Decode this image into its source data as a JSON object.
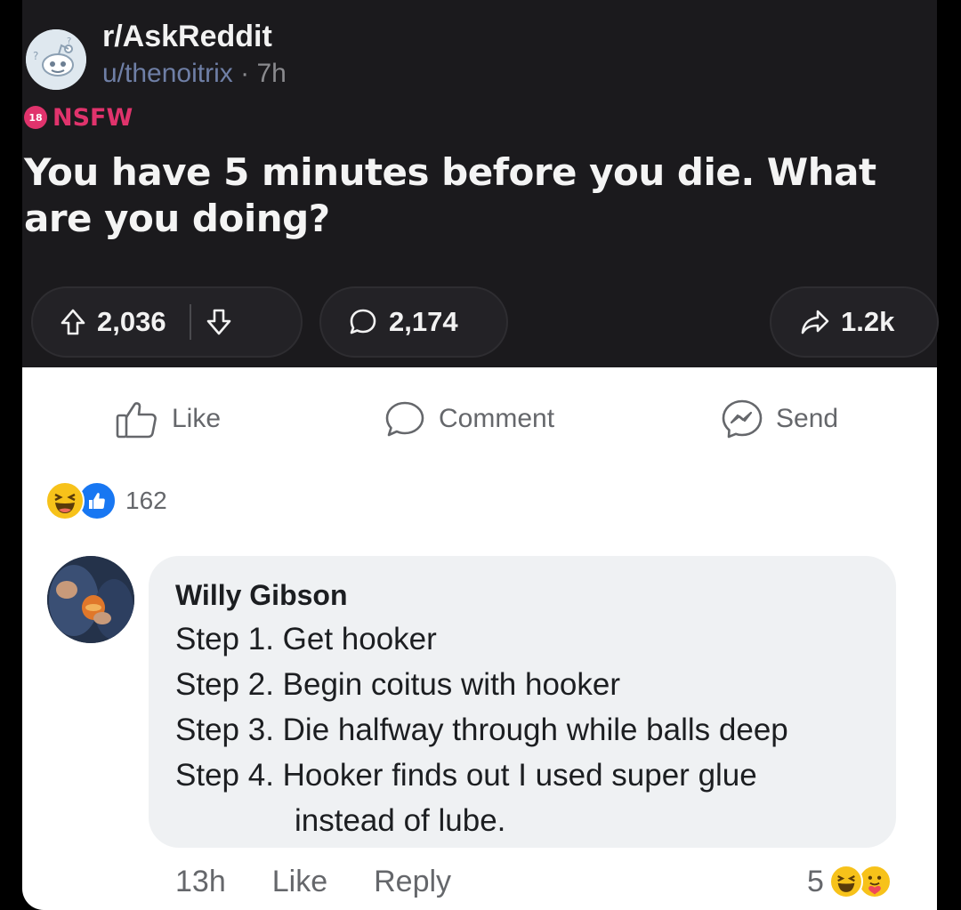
{
  "reddit_post": {
    "subreddit": "r/AskReddit",
    "author": "u/thenoitrix",
    "separator": "·",
    "age": "7h",
    "nsfw_label": "NSFW",
    "title": "You have 5 minutes before you die. What are you doing?",
    "upvotes": "2,036",
    "comments": "2,174",
    "shares": "1.2k"
  },
  "facebook": {
    "actions": {
      "like_label": "Like",
      "comment_label": "Comment",
      "send_label": "Send"
    },
    "reactions": {
      "icons": [
        "haha-reaction-icon",
        "like-reaction-icon"
      ],
      "count": "162"
    },
    "comment": {
      "author": "Willy Gibson",
      "lines": [
        "Step 1. Get hooker",
        "Step 2. Begin coitus with hooker",
        "Step 3. Die halfway through while balls deep",
        "Step 4. Hooker finds out I used super glue",
        "instead of lube."
      ],
      "time": "13h",
      "like_label": "Like",
      "reply_label": "Reply",
      "reaction_count": "5",
      "reaction_icons": [
        "haha-reaction-icon",
        "care-reaction-icon"
      ]
    }
  },
  "colors": {
    "reddit_bg": "#1b1a1d",
    "nsfw": "#e0336c",
    "fb_blue": "#1877f2",
    "bubble_bg": "#eff1f3"
  }
}
